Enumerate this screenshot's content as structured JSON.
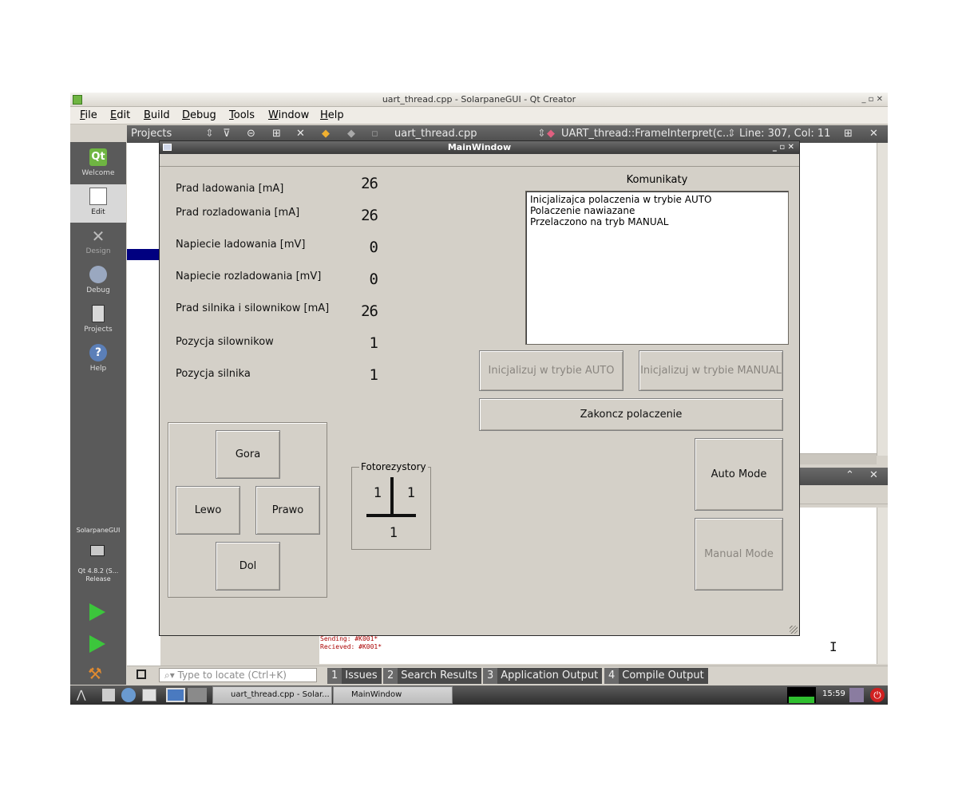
{
  "creator": {
    "title": "uart_thread.cpp - SolarpaneGUI - Qt Creator",
    "window_controls": "_ ▫ ✕",
    "menu": [
      "File",
      "Edit",
      "Build",
      "Debug",
      "Tools",
      "Window",
      "Help"
    ],
    "modes": [
      {
        "label": "Welcome",
        "icon": "qt-logo-icon"
      },
      {
        "label": "Edit",
        "icon": "edit-document-icon"
      },
      {
        "label": "Design",
        "icon": "design-pen-icon"
      },
      {
        "label": "Debug",
        "icon": "debug-bug-icon"
      },
      {
        "label": "Projects",
        "icon": "projects-book-icon"
      },
      {
        "label": "Help",
        "icon": "help-question-icon"
      }
    ],
    "kit": {
      "project": "SolarpaneGUI",
      "version": "Qt 4.8.2 (S...",
      "build": "Release"
    },
    "toolbar": {
      "projects": "Projects",
      "file": "uart_thread.cpp",
      "symbol": "UART_thread::FrameInterpret(c...",
      "position": "Line: 307, Col: 11"
    },
    "output_log": [
      "Sending: #K001*",
      "Recieved: #K001*"
    ],
    "locator_placeholder": "Type to locate (Ctrl+K)",
    "output_tabs": [
      {
        "num": "1",
        "name": "Issues"
      },
      {
        "num": "2",
        "name": "Search Results"
      },
      {
        "num": "3",
        "name": "Application Output"
      },
      {
        "num": "4",
        "name": "Compile Output"
      }
    ]
  },
  "taskbar": {
    "tasks": [
      "uart_thread.cpp - Solar...",
      "MainWindow"
    ],
    "clock": "15:59"
  },
  "main_window": {
    "title": "MainWindow",
    "measurements": [
      {
        "label": "Prad ladowania [mA]",
        "value": "26"
      },
      {
        "label": "Prad rozladowania [mA]",
        "value": "26"
      },
      {
        "label": "Napiecie ladowania [mV]",
        "value": "0"
      },
      {
        "label": "Napiecie rozladowania [mV]",
        "value": "0"
      },
      {
        "label": "Prad silnika i silownikow [mA]",
        "value": "26"
      },
      {
        "label": "Pozycja silownikow",
        "value": "1"
      },
      {
        "label": "Pozycja silnika",
        "value": "1"
      }
    ],
    "messages_label": "Komunikaty",
    "messages": [
      "Inicjalizajca polaczenia w trybie AUTO",
      "Polaczenie nawiazane",
      "Przelaczono na tryb MANUAL"
    ],
    "buttons": {
      "init_auto": "Inicjalizuj w trybie AUTO",
      "init_manual": "Inicjalizuj w trybie MANUAL",
      "disconnect": "Zakoncz polaczenie",
      "auto_mode": "Auto Mode",
      "manual_mode": "Manual Mode",
      "up": "Gora",
      "left": "Lewo",
      "right": "Prawo",
      "down": "Dol"
    },
    "photoresistors": {
      "title": "Fotorezystory",
      "top_left": "1",
      "top_right": "1",
      "bottom": "1"
    }
  }
}
